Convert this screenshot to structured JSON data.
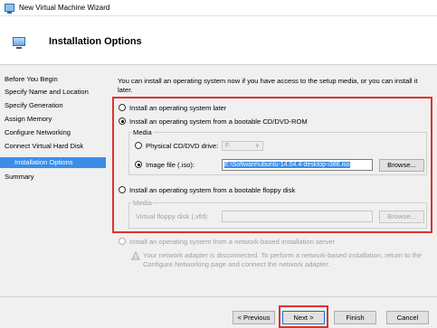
{
  "window": {
    "title": "New Virtual Machine Wizard"
  },
  "header": {
    "title": "Installation Options"
  },
  "sidebar": {
    "items": [
      {
        "label": "Before You Begin"
      },
      {
        "label": "Specify Name and Location"
      },
      {
        "label": "Specify Generation"
      },
      {
        "label": "Assign Memory"
      },
      {
        "label": "Configure Networking"
      },
      {
        "label": "Connect Virtual Hard Disk"
      },
      {
        "label": "Installation Options"
      },
      {
        "label": "Summary"
      }
    ]
  },
  "content": {
    "intro": "You can install an operating system now if you have access to the setup media, or you can install it later.",
    "option_later": "Install an operating system later",
    "option_cd": "Install an operating system from a bootable CD/DVD-ROM",
    "media_label": "Media",
    "physical_drive_label": "Physical CD/DVD drive:",
    "physical_drive_value": "F:",
    "image_file_label": "Image file (.iso):",
    "image_file_value": "E:\\Software\\ubuntu-14.04.4-desktop-i386.iso",
    "browse_label": "Browse...",
    "option_floppy": "Install an operating system from a bootable floppy disk",
    "floppy_media_label": "Media",
    "floppy_disk_label": "Virtual floppy disk (.vfd):",
    "floppy_browse_label": "Browse...",
    "option_network": "Install an operating system from a network-based installation server",
    "network_note": "Your network adapter is disconnected. To perform a network-based installation, return to the Configure Networking page and connect the network adapter."
  },
  "footer": {
    "previous": "< Previous",
    "next": "Next >",
    "finish": "Finish",
    "cancel": "Cancel"
  },
  "colors": {
    "accent": "#3a8ee6",
    "highlight_border": "#e03030"
  }
}
